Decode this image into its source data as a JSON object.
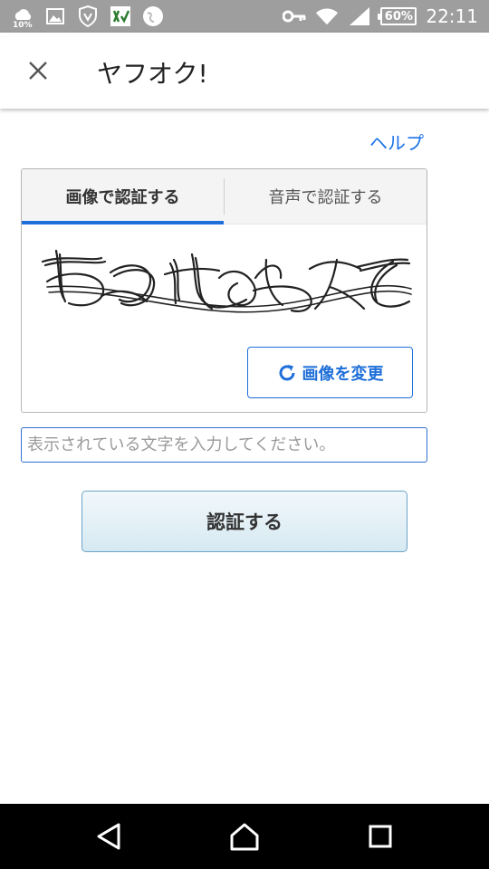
{
  "status_bar": {
    "left_icons": [
      "weather-icon",
      "image-icon",
      "shield-icon",
      "app-icon",
      "globe-icon"
    ],
    "weather_badge": "10%",
    "battery": "60%",
    "time": "22:11"
  },
  "app_bar": {
    "close_icon": "close-icon",
    "title": "ヤフオク!"
  },
  "help": {
    "label": "ヘルプ"
  },
  "captcha": {
    "tabs": [
      {
        "label": "画像で認証する",
        "active": true
      },
      {
        "label": "音声で認証する",
        "active": false
      }
    ],
    "change_image_label": "画像を変更"
  },
  "input": {
    "placeholder": "表示されている文字を入力してください。",
    "value": ""
  },
  "submit": {
    "label": "認証する"
  },
  "colors": {
    "accent": "#1e6fd9",
    "link": "#1a73e8",
    "status_bar": "#9e9e9e",
    "nav_bar": "#000000"
  }
}
